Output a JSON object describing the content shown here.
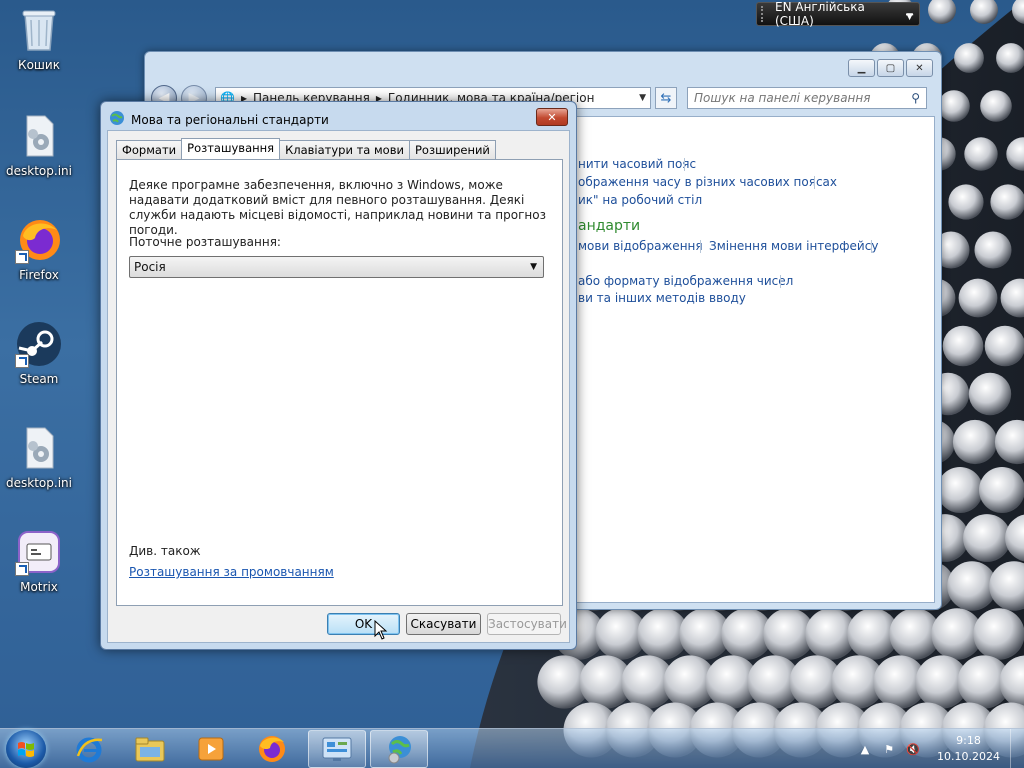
{
  "desktop": {
    "icons": [
      {
        "label": "Кошик",
        "icon": "recycle-bin-icon"
      },
      {
        "label": "desktop.ini",
        "icon": "settings-file-icon"
      },
      {
        "label": "Firefox",
        "icon": "firefox-icon"
      },
      {
        "label": "Steam",
        "icon": "steam-icon"
      },
      {
        "label": "desktop.ini",
        "icon": "settings-file-icon"
      },
      {
        "label": "Motrix",
        "icon": "motrix-icon"
      }
    ]
  },
  "language_bar": {
    "label": "EN Англійська (США)"
  },
  "control_panel": {
    "breadcrumbs": [
      "Панель керування",
      "Годинник, мова та країна/регіон"
    ],
    "search_placeholder": "Пошук на панелі керування",
    "links": {
      "timezone": "нити часовий пояс",
      "clocks": "ображення часу в різних часових поясах",
      "gadget": "ик\" на робочий стіл",
      "heading": "андарти",
      "display_lang": "мови відображення",
      "ui_lang": "Змінення мови інтерфейсу",
      "formats": "або формату відображення чисел",
      "input": "ви та інших методів вводу"
    }
  },
  "dialog": {
    "title": "Мова та регіональні стандарти",
    "tabs": [
      "Формати",
      "Розташування",
      "Клавіатури та мови",
      "Розширений"
    ],
    "active_tab": "Розташування",
    "description": "Деяке програмне забезпечення, включно з Windows, може надавати додатковий вміст для певного розташування. Деякі служби надають місцеві відомості, наприклад новини та прогноз погоди.",
    "current_location_label": "Поточне розташування:",
    "current_location_value": "Росія",
    "see_also": "Див. також",
    "default_location_link": "Розташування за промовчанням",
    "buttons": {
      "ok": "OK",
      "cancel": "Скасувати",
      "apply": "Застосувати"
    }
  },
  "taskbar": {
    "pinned": [
      "internet-explorer-icon",
      "explorer-icon",
      "media-player-icon",
      "firefox-icon",
      "control-panel-icon",
      "region-globe-icon"
    ],
    "clock": {
      "time": "9:18",
      "date": "10.10.2024"
    }
  },
  "colors": {
    "accent": "#1e4f9a",
    "link": "#1a56b0",
    "heading_green": "#2f8a2f",
    "close_red": "#c24a31"
  }
}
